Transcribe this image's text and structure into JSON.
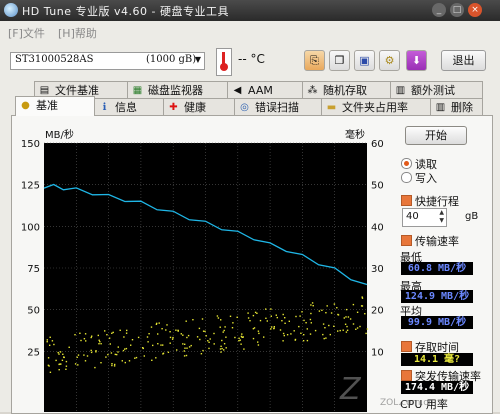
{
  "window": {
    "title": "HD Tune 专业版 v4.60 - 硬盘专业工具"
  },
  "titlebar_buttons": {
    "minimize": "_",
    "maximize": "□",
    "close": "×"
  },
  "menu": {
    "file": "[F]文件",
    "help": "[H]帮助"
  },
  "drive": {
    "name": "ST31000528AS",
    "capacity": "(1000 gB)"
  },
  "temperature": {
    "value": "--",
    "unit": "°C"
  },
  "toolbar": {
    "exit_label": "退出"
  },
  "tabs_back": [
    {
      "label": "文件基准",
      "icon": "document-icon"
    },
    {
      "label": "磁盘监视器",
      "icon": "monitor-icon"
    },
    {
      "label": "AAM",
      "icon": "speaker-icon"
    },
    {
      "label": "随机存取",
      "icon": "random-access-icon"
    },
    {
      "label": "额外测试",
      "icon": "extra-tests-icon"
    }
  ],
  "tabs_front": [
    {
      "label": "基准",
      "icon": "benchmark-icon",
      "active": true
    },
    {
      "label": "信息",
      "icon": "info-icon"
    },
    {
      "label": "健康",
      "icon": "health-icon"
    },
    {
      "label": "错误扫描",
      "icon": "error-scan-icon"
    },
    {
      "label": "文件夹占用率",
      "icon": "folder-icon"
    },
    {
      "label": "删除",
      "icon": "delete-icon"
    }
  ],
  "controls": {
    "start_label": "开始",
    "read_label": "读取",
    "write_label": "写入",
    "read_selected": true,
    "short_stroke_label": "快捷行程",
    "short_stroke_value": "40",
    "short_stroke_unit": "gB",
    "transfer_rate_label": "传输速率",
    "min_label": "最低",
    "min_value": "60.8 MB/秒",
    "max_label": "最高",
    "max_value": "124.9 MB/秒",
    "avg_label": "平均",
    "avg_value": "99.9 MB/秒",
    "access_time_label": "存取时间",
    "access_time_value": "14.1 毫?",
    "burst_rate_label": "突发传输速率",
    "burst_rate_value": "174.4 MB/秒",
    "cpu_label": "CPU 用率"
  },
  "watermark": {
    "mark": "Z",
    "text": "ZOL.com.cn"
  },
  "chart_data": {
    "type": "line",
    "title": "",
    "ylabel_left": "MB/秒",
    "ylabel_right": "毫秒",
    "y_left_ticks": [
      150,
      125,
      100,
      75,
      50,
      25
    ],
    "y_right_ticks": [
      60,
      50,
      40,
      30,
      20,
      10
    ],
    "ylim_left": [
      0,
      150
    ],
    "ylim_right": [
      0,
      60
    ],
    "grid": true,
    "background": "#000000",
    "series": [
      {
        "name": "",
        "axis": "left",
        "color": "#1fb6e6",
        "x": [
          0,
          3,
          6,
          10,
          15,
          20,
          25,
          30,
          35,
          40,
          45,
          50,
          55,
          60,
          65,
          70,
          75,
          80,
          85,
          90,
          95,
          100
        ],
        "values": [
          124,
          124,
          123,
          122,
          120,
          118,
          116,
          114,
          111,
          108,
          105,
          102,
          99,
          96,
          93,
          89,
          86,
          82,
          78,
          74,
          69,
          64
        ]
      },
      {
        "name": "",
        "axis": "right",
        "type": "scatter",
        "color": "#e6e633",
        "x": [
          0,
          10,
          20,
          30,
          40,
          50,
          60,
          70,
          80,
          90,
          100
        ],
        "values": [
          9,
          10,
          11,
          12,
          13,
          14,
          15,
          16,
          17,
          18,
          19
        ]
      }
    ]
  }
}
